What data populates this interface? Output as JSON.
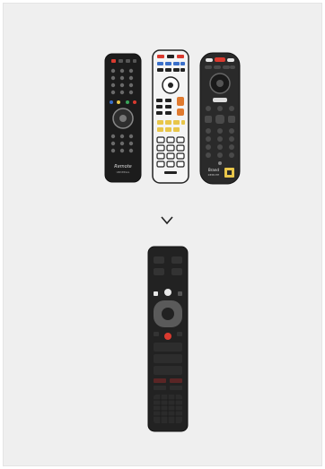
{
  "colors": {
    "background": "#efefef",
    "remote_black": "#1c1c1c",
    "remote_white": "#f4f4f4",
    "remote_gray": "#2a2a2a",
    "accent_red": "#d93a2f",
    "accent_yellow": "#e8c64a",
    "accent_blue": "#3a6fc9",
    "accent_green": "#3aa55a"
  },
  "icons": {
    "arrow": "chevron-down-icon"
  },
  "remotes_top": [
    {
      "brand_text": "Remote",
      "sub_text": "UNIVERSAL"
    },
    {
      "brand_text": "",
      "sub_text": ""
    },
    {
      "brand_text": "Brand",
      "sub_text": "REMOTE"
    }
  ],
  "remote_bottom": {
    "button_text": ""
  }
}
